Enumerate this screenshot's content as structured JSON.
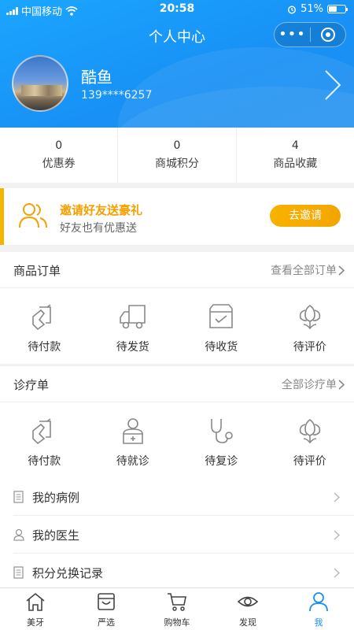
{
  "status_bar": {
    "carrier": "中国移动",
    "time": "20:58",
    "battery": "51%",
    "battery_level": 0.51
  },
  "nav": {
    "title": "个人中心",
    "more_glyph": "•••"
  },
  "profile": {
    "name": "酷鱼",
    "phone": "139****6257"
  },
  "stats": [
    {
      "value": "0",
      "label": "优惠券"
    },
    {
      "value": "0",
      "label": "商城积分"
    },
    {
      "value": "4",
      "label": "商品收藏"
    }
  ],
  "invite": {
    "title": "邀请好友送豪礼",
    "subtitle": "好友也有优惠送",
    "button": "去邀请"
  },
  "orders": {
    "title": "商品订单",
    "more": "查看全部订单",
    "items": [
      {
        "label": "待付款",
        "icon": "wallet-icon"
      },
      {
        "label": "待发货",
        "icon": "truck-icon"
      },
      {
        "label": "待收货",
        "icon": "box-icon"
      },
      {
        "label": "待评价",
        "icon": "flower-icon"
      }
    ]
  },
  "treatments": {
    "title": "诊疗单",
    "more": "全部诊疗单",
    "items": [
      {
        "label": "待付款",
        "icon": "wallet-icon"
      },
      {
        "label": "待就诊",
        "icon": "doctor-icon"
      },
      {
        "label": "待复诊",
        "icon": "stethoscope-icon"
      },
      {
        "label": "待评价",
        "icon": "flower-icon"
      }
    ]
  },
  "menu": [
    {
      "label": "我的病例",
      "icon": "document-icon"
    },
    {
      "label": "我的医生",
      "icon": "person-icon"
    },
    {
      "label": "积分兑换记录",
      "icon": "document-icon"
    }
  ],
  "tabs": [
    {
      "label": "美牙",
      "icon": "home-icon"
    },
    {
      "label": "严选",
      "icon": "shop-icon"
    },
    {
      "label": "购物车",
      "icon": "cart-icon"
    },
    {
      "label": "发现",
      "icon": "eye-icon"
    },
    {
      "label": "我",
      "icon": "user-icon",
      "active": true
    }
  ],
  "colors": {
    "primary": "#1890f5",
    "accent": "#f5a000"
  }
}
